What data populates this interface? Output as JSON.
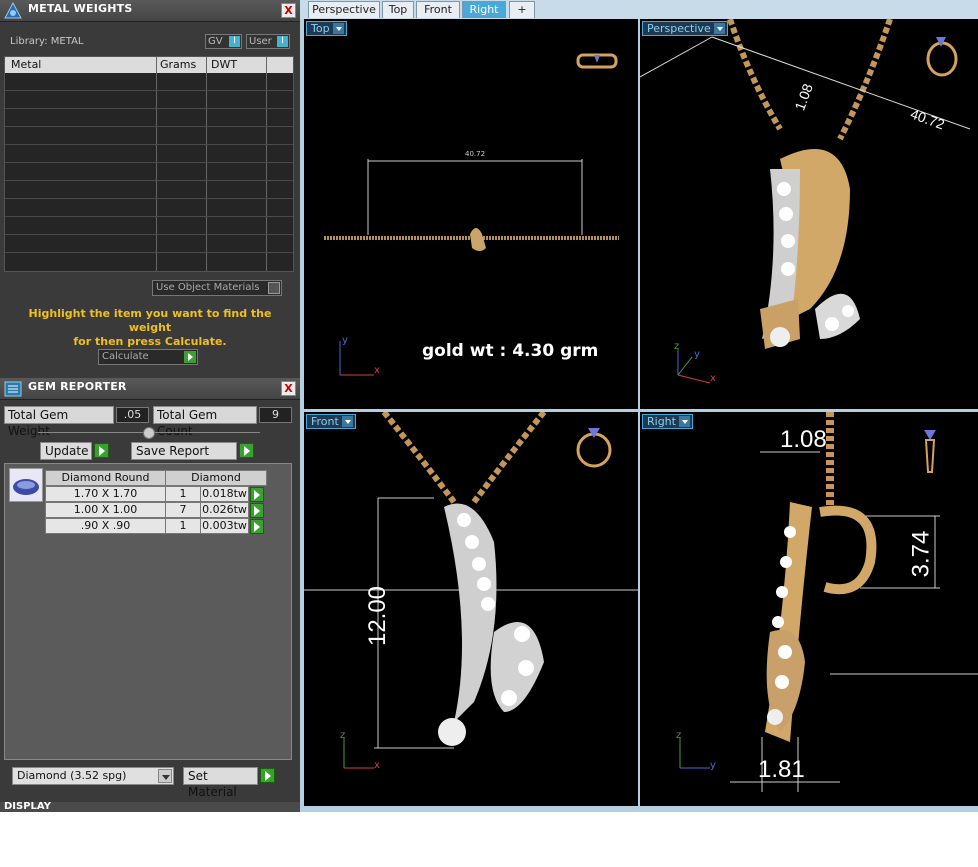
{
  "metal_weights": {
    "title": "METAL WEIGHTS",
    "library_label": "Library: METAL",
    "gv_label": "GV",
    "user_label": "User",
    "columns": [
      "Metal",
      "Grams",
      "DWT"
    ],
    "use_object_materials": "Use Object Materials",
    "hint_line1": "Highlight the item you want to find the weight",
    "hint_line2": "for then press Calculate.",
    "calculate_label": "Calculate",
    "close_label": "X"
  },
  "gem_reporter": {
    "title": "GEM REPORTER",
    "total_weight_label": "Total Gem Weight",
    "total_weight_value": ".05",
    "total_count_label": "Total Gem Count",
    "total_count_value": "9",
    "update_label": "Update",
    "save_report_label": "Save Report",
    "table_header_shape": "Diamond Round",
    "table_header_material": "Diamond",
    "rows": [
      {
        "size": "1.70 X 1.70",
        "count": "1",
        "weight": "0.018tw"
      },
      {
        "size": "1.00 X 1.00",
        "count": "7",
        "weight": "0.026tw"
      },
      {
        "size": ".90 X .90",
        "count": "1",
        "weight": "0.003tw"
      }
    ],
    "material_select": "Diamond      (3.52 spg)",
    "set_material_label": "Set Material",
    "close_label": "X"
  },
  "display_panel": {
    "title": "DISPLAY"
  },
  "tabs": [
    "Perspective",
    "Top",
    "Front",
    "Right",
    "+"
  ],
  "active_tab": "Right",
  "viewports": {
    "top": {
      "label": "Top",
      "dimension": "40.72",
      "annotation": "gold wt : 4.30 grm"
    },
    "perspective": {
      "label": "Perspective",
      "dimension_a": "40.72",
      "dimension_b": "1.08"
    },
    "front": {
      "label": "Front",
      "dimension": "12.00"
    },
    "right": {
      "label": "Right",
      "dimension_top": "1.08",
      "dimension_side": "3.74",
      "dimension_bottom": "1.81"
    }
  },
  "axes": {
    "x": "x",
    "y": "y",
    "z": "z"
  },
  "colors": {
    "accent": "#4aa8d8",
    "hint": "#f0c020",
    "gold": "#d6a35c",
    "panel_bg": "#3a3a3a",
    "green": "#3aa030"
  },
  "icons": [
    "metal-weights-icon",
    "gem-reporter-icon",
    "gem-thumbnail-icon",
    "ring-preview-icon",
    "add-tab-icon"
  ]
}
